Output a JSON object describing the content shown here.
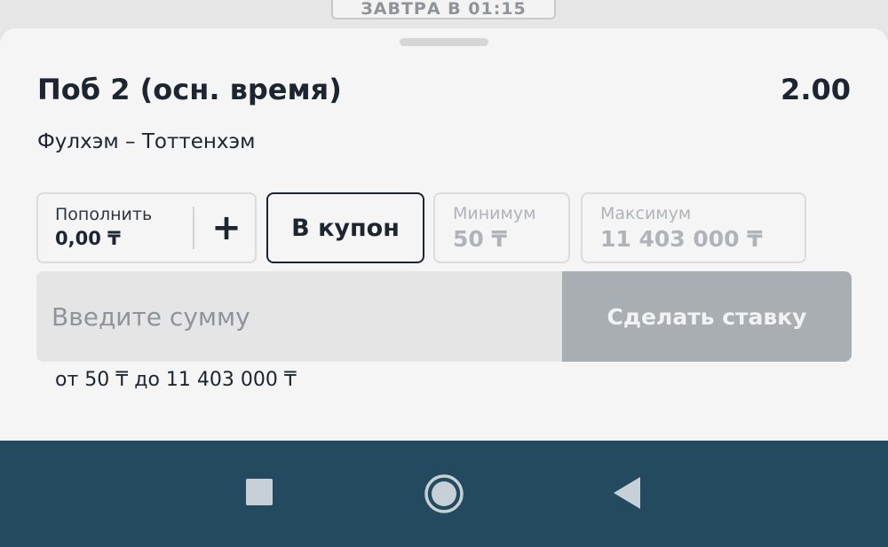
{
  "top_banner": {
    "label": "ЗАВТРА В 01:15"
  },
  "bet": {
    "title": "Поб 2 (осн. время)",
    "odds": "2.00",
    "match": "Фулхэм – Тоттенхэм"
  },
  "deposit": {
    "label": "Пополнить",
    "value": "0,00 ₸",
    "plus": "+"
  },
  "coupon_button": "В купон",
  "limits": {
    "min_label": "Минимум",
    "min_value": "50 ₸",
    "max_label": "Максимум",
    "max_value": "11 403 000 ₸"
  },
  "amount": {
    "placeholder": "Введите сумму",
    "value": ""
  },
  "place_bet_button": "Сделать ставку",
  "range_hint": "от 50 ₸ до 11 403 000 ₸",
  "colors": {
    "navbar": "#234a5f",
    "primary_text": "#1c2530",
    "disabled_button": "#a9aeb3",
    "muted_text": "#b0b4b9"
  },
  "icons": {
    "recent": "square-icon",
    "home": "circle-home-icon",
    "back": "triangle-back-icon"
  }
}
